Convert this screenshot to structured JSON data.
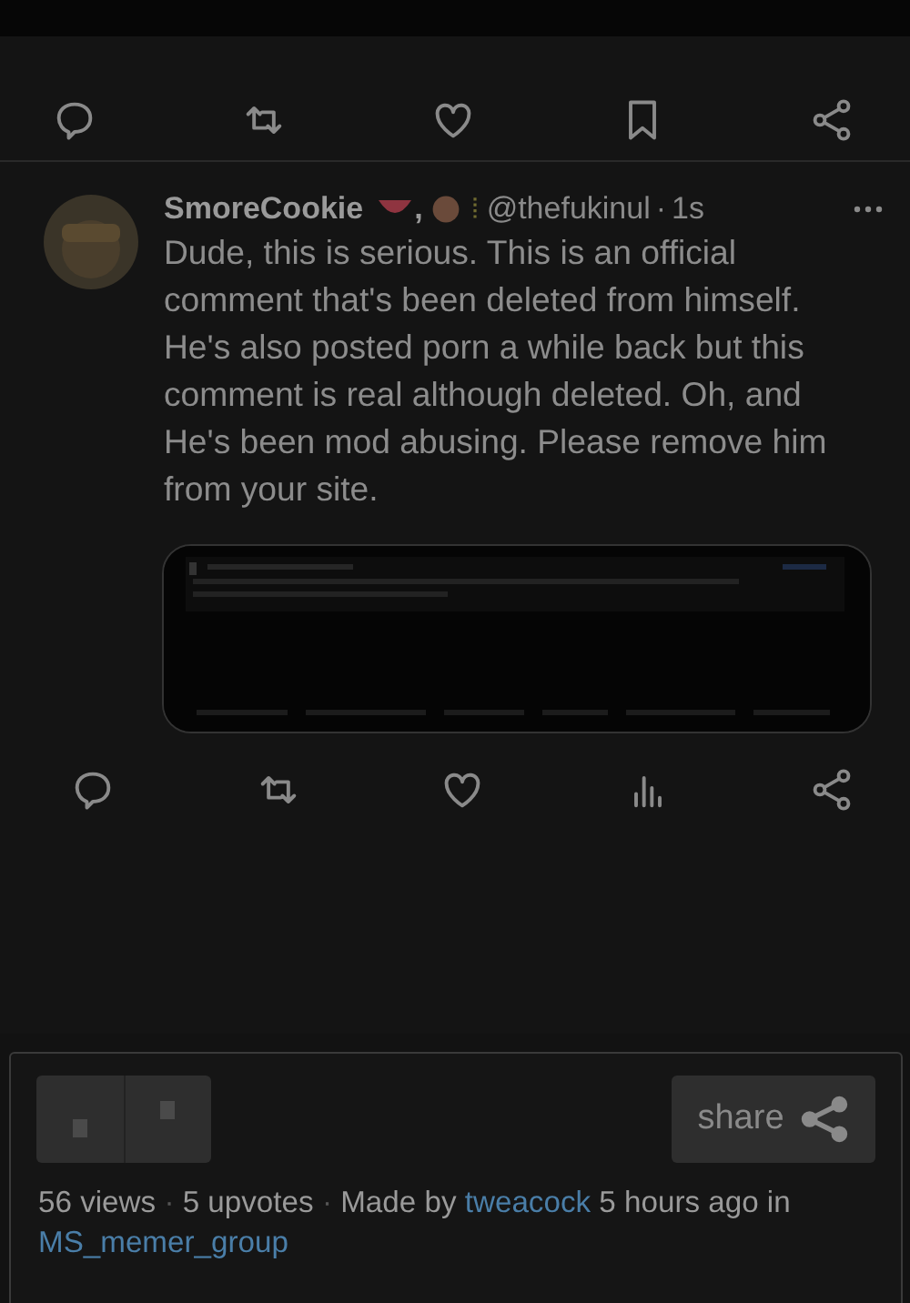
{
  "top_actions": [
    {
      "kind": "reply"
    },
    {
      "kind": "retweet"
    },
    {
      "kind": "like"
    },
    {
      "kind": "bookmark"
    },
    {
      "kind": "share"
    }
  ],
  "tweet": {
    "author": "SmoreCookie",
    "name_emojis": [
      {
        "kind": "melon"
      },
      {
        "kind": "text",
        "text": ","
      },
      {
        "kind": "cookie"
      },
      {
        "kind": "bar"
      }
    ],
    "handle": "@thefukinul",
    "dot": "·",
    "time": "1s",
    "text": "Dude, this is serious. This is an official comment that's been deleted from himself. He's also posted porn a while back but this comment is real although deleted. Oh, and He's been mod abusing. Please remove him from your site.",
    "actions": [
      {
        "kind": "reply"
      },
      {
        "kind": "retweet"
      },
      {
        "kind": "like"
      },
      {
        "kind": "views"
      },
      {
        "kind": "share"
      }
    ]
  },
  "meme_footer": {
    "share_button": "share",
    "stats": [
      {
        "kind": "text",
        "text": "56 views"
      },
      {
        "kind": "sep",
        "text": "·"
      },
      {
        "kind": "text",
        "text": "5 upvotes"
      },
      {
        "kind": "sep",
        "text": "·"
      },
      {
        "kind": "text",
        "text": "Made by"
      },
      {
        "kind": "link",
        "text": "tweacock"
      },
      {
        "kind": "text",
        "text": "5 hours ago in"
      },
      {
        "kind": "link",
        "text": "MS_memer_group"
      }
    ]
  }
}
